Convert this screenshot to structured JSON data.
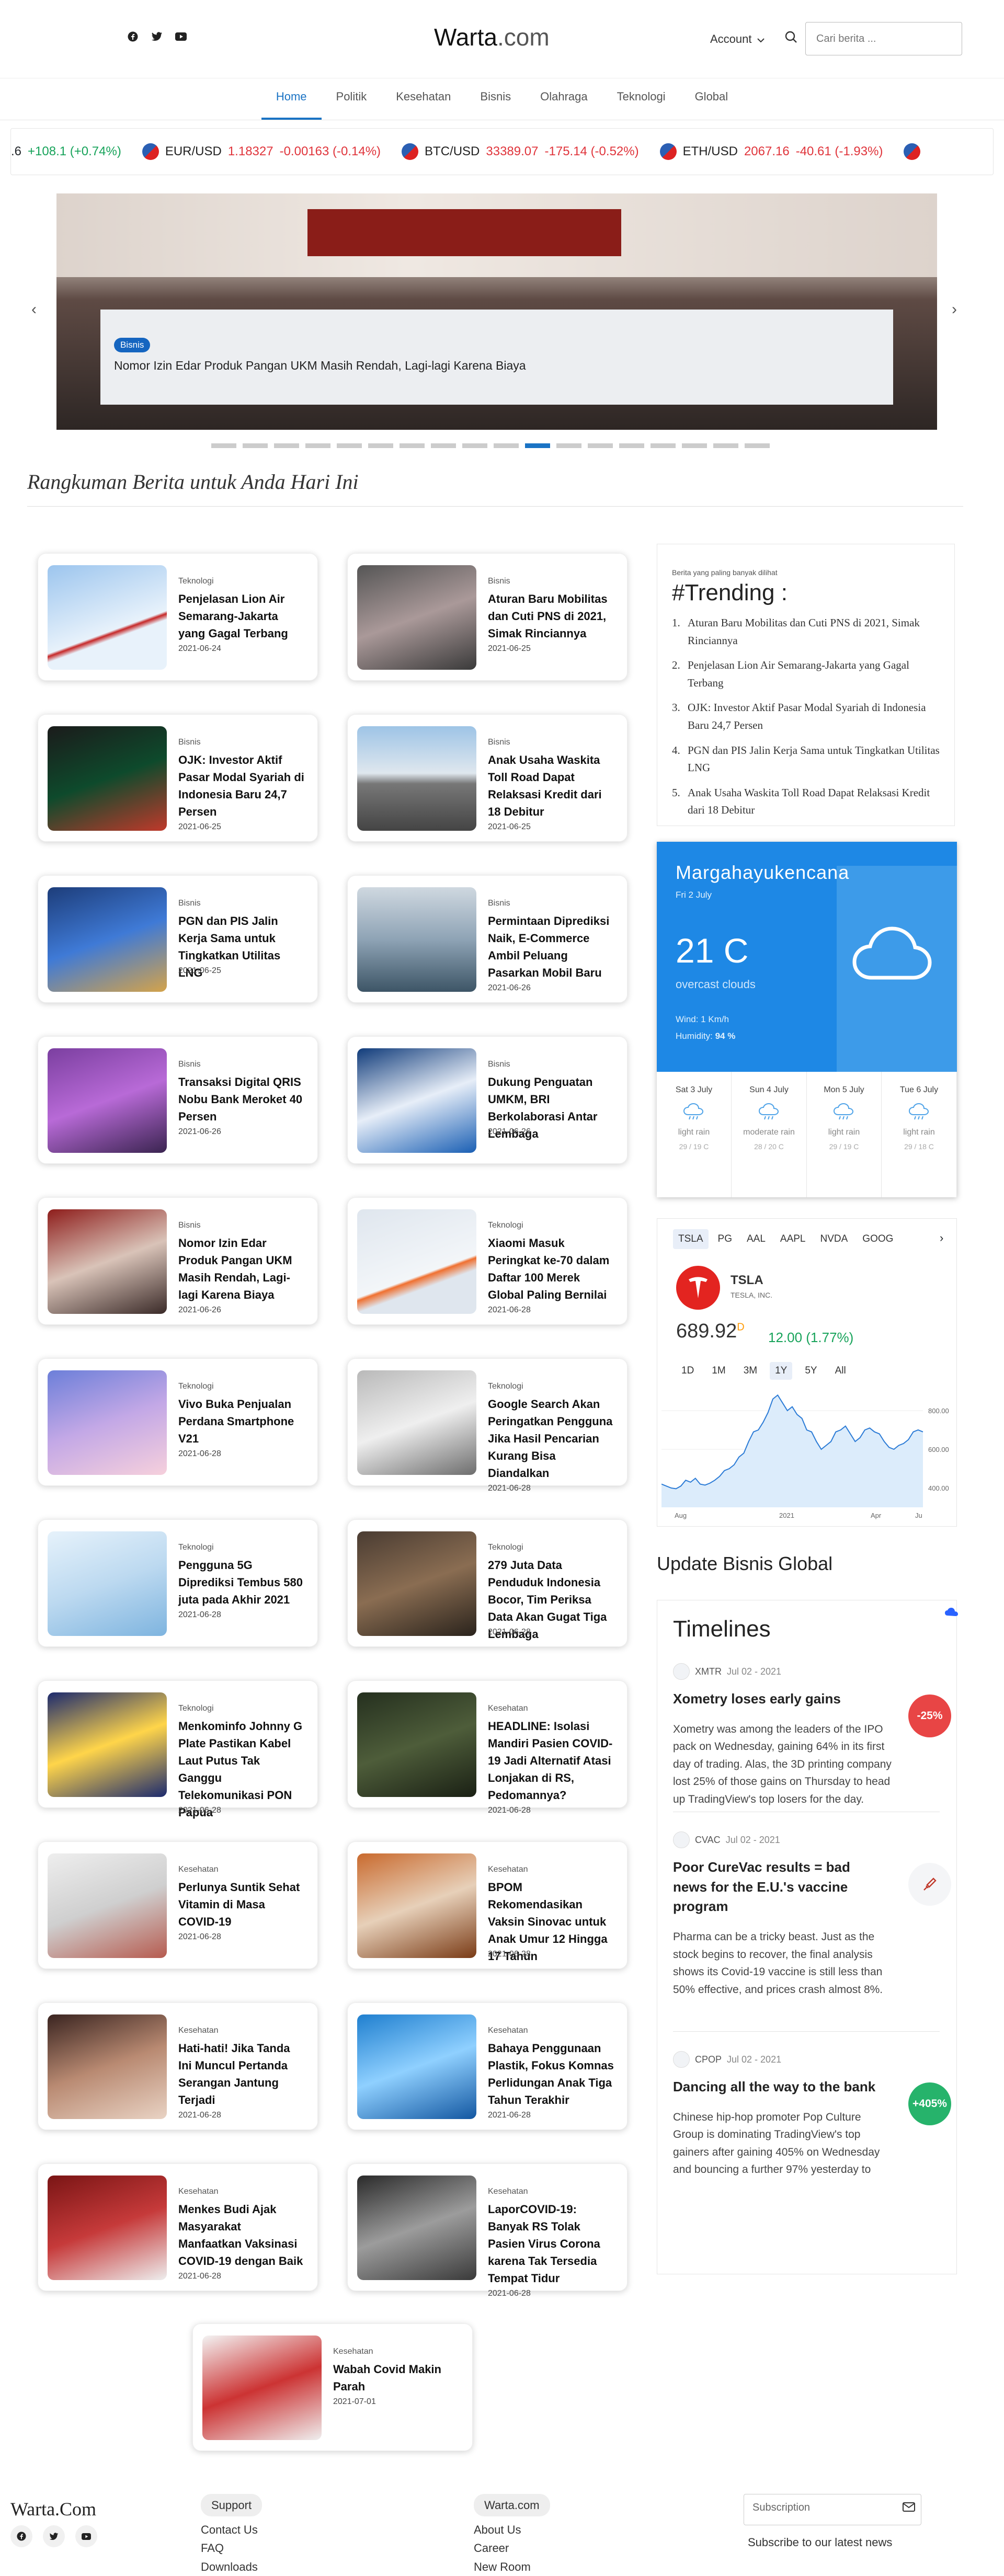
{
  "header": {
    "brand": "Warta",
    "brand_suffix": ".com",
    "account": "Account",
    "search_placeholder": "Cari berita ..."
  },
  "nav": [
    "Home",
    "Politik",
    "Kesehatan",
    "Bisnis",
    "Olahraga",
    "Teknologi",
    "Global"
  ],
  "ticker": [
    {
      "pair": "",
      "price": "",
      "change": "+108.1 (+0.74%)",
      "lead": ".6",
      "dir": "pos"
    },
    {
      "pair": "EUR/USD",
      "price": "1.18327",
      "change": "-0.00163 (-0.14%)",
      "lead": "",
      "dir": "neg"
    },
    {
      "pair": "BTC/USD",
      "price": "33389.07",
      "change": "-175.14 (-0.52%)",
      "lead": "",
      "dir": "neg"
    },
    {
      "pair": "ETH/USD",
      "price": "2067.16",
      "change": "-40.61 (-1.93%)",
      "lead": "",
      "dir": "neg"
    }
  ],
  "carousel": {
    "badge": "Bisnis",
    "caption": "Nomor Izin Edar Produk Pangan UKM Masih Rendah, Lagi-lagi Karena Biaya",
    "slides": 18,
    "active": 10
  },
  "section_title": "Rangkuman Berita untuk Anda Hari Ini",
  "articles": [
    {
      "cat": "Teknologi",
      "title": "Penjelasan Lion Air Semarang-Jakarta yang Gagal Terbang",
      "date": "2021-06-24"
    },
    {
      "cat": "Bisnis",
      "title": "Aturan Baru Mobilitas dan Cuti PNS di 2021, Simak Rinciannya",
      "date": "2021-06-25"
    },
    {
      "cat": "Bisnis",
      "title": "OJK: Investor Aktif Pasar Modal Syariah di Indonesia Baru 24,7 Persen",
      "date": "2021-06-25"
    },
    {
      "cat": "Bisnis",
      "title": "Anak Usaha Waskita Toll Road Dapat Relaksasi Kredit dari 18 Debitur",
      "date": "2021-06-25"
    },
    {
      "cat": "Bisnis",
      "title": "PGN dan PIS Jalin Kerja Sama untuk Tingkatkan Utilitas LNG",
      "date": "2021-06-25"
    },
    {
      "cat": "Bisnis",
      "title": "Permintaan Diprediksi Naik, E-Commerce Ambil Peluang Pasarkan Mobil Baru",
      "date": "2021-06-26"
    },
    {
      "cat": "Bisnis",
      "title": "Transaksi Digital QRIS Nobu Bank Meroket 40 Persen",
      "date": "2021-06-26"
    },
    {
      "cat": "Bisnis",
      "title": "Dukung Penguatan UMKM, BRI Berkolaborasi Antar Lembaga",
      "date": "2021-06-26"
    },
    {
      "cat": "Bisnis",
      "title": "Nomor Izin Edar Produk Pangan UKM Masih Rendah, Lagi-lagi Karena Biaya",
      "date": "2021-06-26"
    },
    {
      "cat": "Teknologi",
      "title": "Xiaomi Masuk Peringkat ke-70 dalam Daftar 100 Merek Global Paling Bernilai",
      "date": "2021-06-28"
    },
    {
      "cat": "Teknologi",
      "title": "Vivo Buka Penjualan Perdana Smartphone V21",
      "date": "2021-06-28"
    },
    {
      "cat": "Teknologi",
      "title": "Google Search Akan Peringatkan Pengguna Jika Hasil Pencarian Kurang Bisa Diandalkan",
      "date": "2021-06-28"
    },
    {
      "cat": "Teknologi",
      "title": "Pengguna 5G Diprediksi Tembus 580 juta pada Akhir 2021",
      "date": "2021-06-28"
    },
    {
      "cat": "Teknologi",
      "title": "279 Juta Data Penduduk Indonesia Bocor, Tim Periksa Data Akan Gugat Tiga Lembaga",
      "date": "2021-06-28"
    },
    {
      "cat": "Teknologi",
      "title": "Menkominfo Johnny G Plate Pastikan Kabel Laut Putus Tak Ganggu Telekomunikasi PON Papua",
      "date": "2021-06-28"
    },
    {
      "cat": "Kesehatan",
      "title": "HEADLINE: Isolasi Mandiri Pasien COVID-19 Jadi Alternatif Atasi Lonjakan di RS, Pedomannya?",
      "date": "2021-06-28"
    },
    {
      "cat": "Kesehatan",
      "title": "Perlunya Suntik Sehat Vitamin di Masa COVID-19",
      "date": "2021-06-28"
    },
    {
      "cat": "Kesehatan",
      "title": "BPOM Rekomendasikan Vaksin Sinovac untuk Anak Umur 12 Hingga 17 Tahun",
      "date": "2021-06-28"
    },
    {
      "cat": "Kesehatan",
      "title": "Hati-hati! Jika Tanda Ini Muncul Pertanda Serangan Jantung Terjadi",
      "date": "2021-06-28"
    },
    {
      "cat": "Kesehatan",
      "title": "Bahaya Penggunaan Plastik, Fokus Komnas Perlidungan Anak Tiga Tahun Terakhir",
      "date": "2021-06-28"
    },
    {
      "cat": "Kesehatan",
      "title": "Menkes Budi Ajak Masyarakat Manfaatkan Vaksinasi COVID-19 dengan Baik",
      "date": "2021-06-28"
    },
    {
      "cat": "Kesehatan",
      "title": "LaporCOVID-19: Banyak RS Tolak Pasien Virus Corona karena Tak Tersedia Tempat Tidur",
      "date": "2021-06-28"
    },
    {
      "cat": "Kesehatan",
      "title": "Wabah Covid Makin Parah",
      "date": "2021-07-01"
    }
  ],
  "trending": {
    "label": "Berita yang paling banyak dilihat",
    "title": "#Trending :",
    "items": [
      "Aturan Baru Mobilitas dan Cuti PNS di 2021, Simak Rinciannya",
      "Penjelasan Lion Air Semarang-Jakarta yang Gagal Terbang",
      "OJK: Investor Aktif Pasar Modal Syariah di Indonesia Baru 24,7 Persen",
      "PGN dan PIS Jalin Kerja Sama untuk Tingkatkan Utilitas LNG",
      "Anak Usaha Waskita Toll Road Dapat Relaksasi Kredit dari 18 Debitur"
    ]
  },
  "weather": {
    "city": "Margahayukencana",
    "date": "Fri 2 July",
    "temp": "21 C",
    "desc": "overcast clouds",
    "wind": "Wind: 1 Km/h",
    "humidity_label": "Humidity: ",
    "humidity": "94 %",
    "forecast": [
      {
        "day": "Sat 3 July",
        "desc": "light rain",
        "range": "29 / 19 C"
      },
      {
        "day": "Sun 4 July",
        "desc": "moderate rain",
        "range": "28 / 20 C"
      },
      {
        "day": "Mon 5 July",
        "desc": "light rain",
        "range": "29 / 19 C"
      },
      {
        "day": "Tue 6 July",
        "desc": "light rain",
        "range": "29 / 18 C"
      }
    ]
  },
  "stock": {
    "tabs": [
      "TSLA",
      "PG",
      "AAL",
      "AAPL",
      "NVDA",
      "GOOG"
    ],
    "symbol": "TSLA",
    "name": "TESLA, INC.",
    "price": "689.92",
    "price_sup": "D",
    "change": "12.00 (1.77%)",
    "ranges": [
      "1D",
      "1M",
      "3M",
      "1Y",
      "5Y",
      "All"
    ],
    "active_range": "1Y",
    "y_ticks": [
      "800.00",
      "600.00",
      "400.00"
    ],
    "x_ticks": [
      "Aug",
      "2021",
      "Apr",
      "Ju"
    ],
    "series": [
      420,
      410,
      400,
      396,
      410,
      440,
      430,
      450,
      420,
      415,
      425,
      440,
      460,
      490,
      500,
      520,
      560,
      580,
      640,
      690,
      700,
      740,
      790,
      860,
      880,
      840,
      800,
      820,
      780,
      760,
      700,
      690,
      640,
      600,
      620,
      640,
      690,
      700,
      720,
      680,
      640,
      660,
      700,
      710,
      690,
      680,
      640,
      610,
      600,
      620,
      630,
      650,
      690,
      700,
      690
    ]
  },
  "biz_title": "Update Bisnis Global",
  "timeline": {
    "title": "Timelines",
    "items": [
      {
        "sym": "XMTR",
        "date": "Jul 02 - 2021",
        "title": "Xometry loses early gains",
        "text": "Xometry was among the leaders of the IPO pack on Wednesday, gaining 64% in its first day of trading. Alas, the 3D printing company lost 25% of those gains on Thursday to head up TradingView's top losers for the day.",
        "badge": "-25%",
        "badge_color": "#e84545"
      },
      {
        "sym": "CVAC",
        "date": "Jul 02 - 2021",
        "title": "Poor CureVac results = bad news for the E.U.'s vaccine program",
        "text": "Pharma can be a tricky beast. Just as the stock begins to recover, the final analysis shows its Covid-19 vaccine is still less than 50% effective, and prices crash almost 8%.",
        "badge": "",
        "badge_color": "#f4f5f7"
      },
      {
        "sym": "CPOP",
        "date": "Jul 02 - 2021",
        "title": "Dancing all the way to the bank",
        "text": "Chinese hip-hop promoter Pop Culture Group is dominating TradingView's top gainers after gaining 405% on Wednesday and bouncing a further 97% yesterday to",
        "badge": "+405%",
        "badge_color": "#26b36b"
      }
    ]
  },
  "footer": {
    "brand": "Warta.Com",
    "support_title": "Support",
    "support": [
      "Contact Us",
      "FAQ",
      "Downloads"
    ],
    "company_title": "Warta.com",
    "company": [
      "About Us",
      "Career",
      "New Room"
    ],
    "subscribe_placeholder": "Subscription",
    "subscribe_text": "Subscribe to our latest news"
  }
}
